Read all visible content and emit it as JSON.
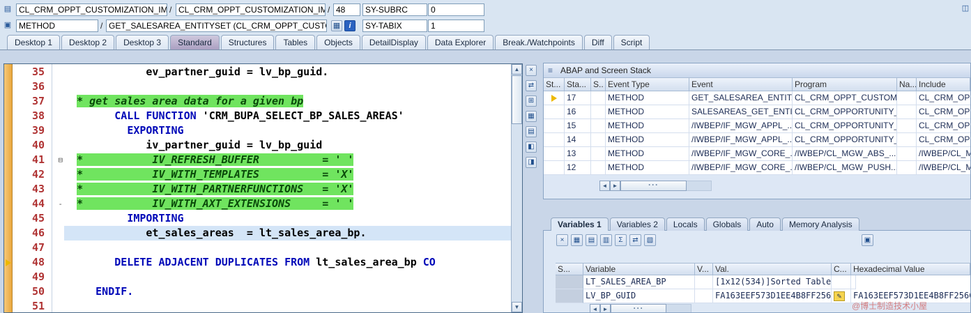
{
  "header": {
    "row1": {
      "field1": "CL_CRM_OPPT_CUSTOMIZATION_IMP..",
      "sep1": "/",
      "field2": "CL_CRM_OPPT_CUSTOMIZATION_IMP...",
      "sep2": "/",
      "line": "48",
      "sy_subrc_label": "SY-SUBRC",
      "sy_subrc_value": "0"
    },
    "row2": {
      "kind": "METHOD",
      "sep": "/",
      "event": "GET_SALESAREA_ENTITYSET (CL_CRM_OPPT_CUSTO...",
      "sy_tabix_label": "SY-TABIX",
      "sy_tabix_value": "1"
    }
  },
  "tabs": [
    {
      "label": "Desktop 1"
    },
    {
      "label": "Desktop 2"
    },
    {
      "label": "Desktop 3"
    },
    {
      "label": "Standard",
      "active": true
    },
    {
      "label": "Structures"
    },
    {
      "label": "Tables"
    },
    {
      "label": "Objects"
    },
    {
      "label": "DetailDisplay"
    },
    {
      "label": "Data Explorer"
    },
    {
      "label": "Break./Watchpoints"
    },
    {
      "label": "Diff"
    },
    {
      "label": "Script"
    }
  ],
  "editor": {
    "lines": [
      {
        "num": "35",
        "segs": [
          {
            "c": "t",
            "t": "             ev_partner_guid = lv_bp_guid."
          }
        ]
      },
      {
        "num": "36",
        "segs": []
      },
      {
        "num": "37",
        "segs": [
          {
            "c": "t",
            "t": "  "
          },
          {
            "c": "c",
            "t": "* get sales area data for a given bp"
          }
        ]
      },
      {
        "num": "38",
        "segs": [
          {
            "c": "t",
            "t": "        "
          },
          {
            "c": "k",
            "t": "CALL FUNCTION"
          },
          {
            "c": "s",
            "t": " 'CRM_BUPA_SELECT_BP_SALES_AREAS'"
          }
        ]
      },
      {
        "num": "39",
        "segs": [
          {
            "c": "t",
            "t": "          "
          },
          {
            "c": "k",
            "t": "EXPORTING"
          }
        ]
      },
      {
        "num": "40",
        "segs": [
          {
            "c": "t",
            "t": "             iv_partner_guid = lv_bp_guid"
          }
        ]
      },
      {
        "num": "41",
        "fold": "⊟",
        "segs": [
          {
            "c": "t",
            "t": "  "
          },
          {
            "c": "c",
            "t": "*           IV_REFRESH_BUFFER          = ' '"
          }
        ]
      },
      {
        "num": "42",
        "segs": [
          {
            "c": "t",
            "t": "  "
          },
          {
            "c": "c",
            "t": "*           IV_WITH_TEMPLATES          = 'X'"
          }
        ]
      },
      {
        "num": "43",
        "segs": [
          {
            "c": "t",
            "t": "  "
          },
          {
            "c": "c",
            "t": "*           IV_WITH_PARTNERFUNCTIONS   = 'X'"
          }
        ]
      },
      {
        "num": "44",
        "fold": "-",
        "segs": [
          {
            "c": "t",
            "t": "  "
          },
          {
            "c": "c",
            "t": "*           IV_WITH_AXT_EXTENSIONS     = ' '"
          }
        ]
      },
      {
        "num": "45",
        "segs": [
          {
            "c": "t",
            "t": "          "
          },
          {
            "c": "k",
            "t": "IMPORTING"
          }
        ]
      },
      {
        "num": "46",
        "bg": "current",
        "segs": [
          {
            "c": "t",
            "t": "             et_sales_areas  = lt_sales_area_bp."
          }
        ]
      },
      {
        "num": "47",
        "segs": []
      },
      {
        "num": "48",
        "mark": "arrow",
        "segs": [
          {
            "c": "t",
            "t": "        "
          },
          {
            "c": "k",
            "t": "DELETE ADJACENT DUPLICATES FROM"
          },
          {
            "c": "t",
            "t": " lt_sales_area_bp "
          },
          {
            "c": "k",
            "t": "CO"
          }
        ]
      },
      {
        "num": "49",
        "segs": []
      },
      {
        "num": "50",
        "segs": [
          {
            "c": "t",
            "t": "     "
          },
          {
            "c": "k",
            "t": "ENDIF."
          }
        ]
      },
      {
        "num": "51",
        "segs": []
      }
    ]
  },
  "dock_icons": [
    {
      "name": "close-icon",
      "glyph": "×"
    },
    {
      "name": "swap-panels-icon",
      "glyph": "⇄"
    },
    {
      "name": "maximize-icon",
      "glyph": "⊞"
    },
    {
      "name": "grid-view-icon",
      "glyph": "▦"
    },
    {
      "name": "form-view-icon",
      "glyph": "▤"
    },
    {
      "name": "lock-icon",
      "glyph": "◧"
    },
    {
      "name": "services-icon",
      "glyph": "◨"
    }
  ],
  "stack": {
    "title": "ABAP and Screen Stack",
    "columns": [
      "St...",
      "Sta...",
      "S..",
      "Event Type",
      "Event",
      "Program",
      "Na...",
      "Include"
    ],
    "rows": [
      {
        "mark": "arrow",
        "level": "17",
        "type": "METHOD",
        "event": "GET_SALESAREA_ENTIT...",
        "program": "CL_CRM_OPPT_CUSTOM...",
        "include": "CL_CRM_OPPT..."
      },
      {
        "level": "16",
        "type": "METHOD",
        "event": "SALESAREAS_GET_ENTI...",
        "program": "CL_CRM_OPPORTUNITY_...",
        "include": "CL_CRM_OPPO..."
      },
      {
        "level": "15",
        "type": "METHOD",
        "event": "/IWBEP/IF_MGW_APPL_...",
        "program": "CL_CRM_OPPORTUNITY_...",
        "include": "CL_CRM_OPPO..."
      },
      {
        "level": "14",
        "type": "METHOD",
        "event": "/IWBEP/IF_MGW_APPL_...",
        "program": "CL_CRM_OPPORTUNITY_...",
        "include": "CL_CRM_OPPO..."
      },
      {
        "level": "13",
        "type": "METHOD",
        "event": "/IWBEP/IF_MGW_CORE_...",
        "program": "/IWBEP/CL_MGW_ABS_...",
        "include": "/IWBEP/CL_MG..."
      },
      {
        "level": "12",
        "type": "METHOD",
        "event": "/IWBEP/IF_MGW_CORE_...",
        "program": "/IWBEP/CL_MGW_PUSH...",
        "include": "/IWBEP/CL_MG..."
      }
    ]
  },
  "variables": {
    "tabs": [
      {
        "label": "Variables 1",
        "active": true
      },
      {
        "label": "Variables 2"
      },
      {
        "label": "Locals"
      },
      {
        "label": "Globals"
      },
      {
        "label": "Auto"
      },
      {
        "label": "Memory Analysis"
      }
    ],
    "toolbar_icons": [
      {
        "name": "delete-icon",
        "glyph": "×"
      },
      {
        "name": "layout-icon",
        "glyph": "▦"
      },
      {
        "name": "table-settings-icon",
        "glyph": "▤"
      },
      {
        "name": "save-layout-icon",
        "glyph": "▥"
      },
      {
        "name": "sum-icon",
        "glyph": "Σ"
      },
      {
        "name": "compare-icon",
        "glyph": "⇄"
      },
      {
        "name": "filter-icon",
        "glyph": "▧"
      }
    ],
    "save_icon_glyph": "▣",
    "columns": [
      "S...",
      "Variable",
      "V...",
      "Val.",
      "C...",
      "Hexadecimal Value"
    ],
    "rows": [
      {
        "variable": "LT_SALES_AREA_BP",
        "val": "[1x12(534)]Sorted Table",
        "hex": ""
      },
      {
        "variable": "LV_BP_GUID",
        "val": "FA163EEF573D1EE4B8FF256C...",
        "edit": true,
        "hex": "FA163EEF573D1EE4B8FF256C..."
      }
    ]
  },
  "icons": {
    "object_icon": "▤",
    "method_icon": "▣",
    "table_icon": "▦",
    "info_icon": "i",
    "window_icon": "◫",
    "stack_icon": "≡"
  },
  "scrollbar": {
    "up": "▲",
    "down": "▼",
    "left": "◄",
    "right": "►",
    "grip": "···"
  },
  "watermark": "@博士制造技术小屋"
}
